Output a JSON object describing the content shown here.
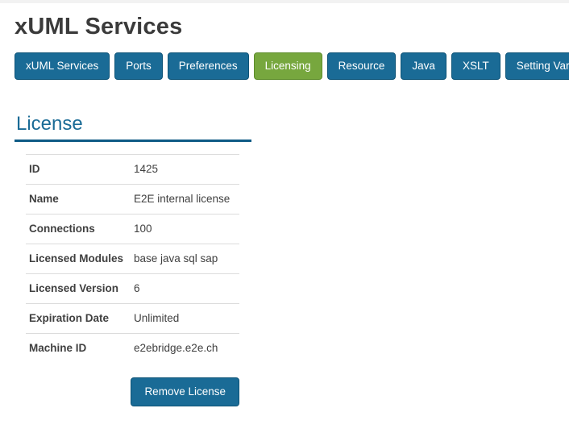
{
  "page": {
    "title": "xUML Services"
  },
  "tabs": [
    {
      "label": "xUML Services",
      "active": false
    },
    {
      "label": "Ports",
      "active": false
    },
    {
      "label": "Preferences",
      "active": false
    },
    {
      "label": "Licensing",
      "active": true
    },
    {
      "label": "Resource",
      "active": false
    },
    {
      "label": "Java",
      "active": false
    },
    {
      "label": "XSLT",
      "active": false
    },
    {
      "label": "Setting Variables",
      "active": false
    }
  ],
  "section": {
    "heading": "License"
  },
  "license": {
    "rows": [
      {
        "label": "ID",
        "value": "1425"
      },
      {
        "label": "Name",
        "value": "E2E internal license"
      },
      {
        "label": "Connections",
        "value": "100"
      },
      {
        "label": "Licensed Modules",
        "value": "base java sql sap"
      },
      {
        "label": "Licensed Version",
        "value": "6"
      },
      {
        "label": "Expiration Date",
        "value": "Unlimited"
      },
      {
        "label": "Machine ID",
        "value": "e2ebridge.e2e.ch"
      }
    ],
    "remove_button_label": "Remove License"
  },
  "colors": {
    "accent_blue": "#1a6b96",
    "active_green": "#77a73e",
    "heading_underline": "#0e5a85",
    "row_border": "#dcdcdc",
    "text": "#404040"
  }
}
